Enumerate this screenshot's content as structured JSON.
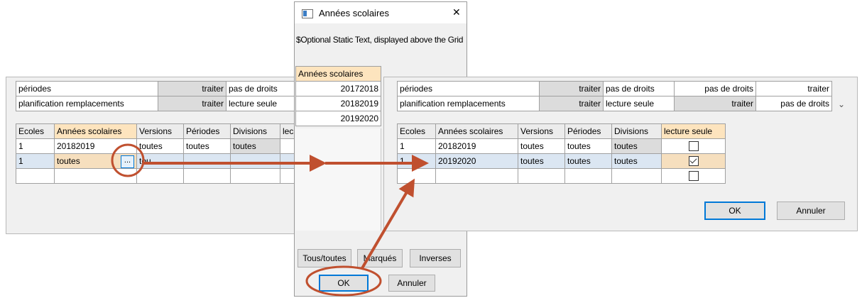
{
  "left_window": {
    "top_rows": [
      {
        "name": "périodes",
        "action": "traiter",
        "rights": "pas de droits"
      },
      {
        "name": "planification remplacements",
        "action": "traiter",
        "rights": "lecture seule"
      }
    ],
    "columns": [
      "Ecoles",
      "Années scolaires",
      "Versions",
      "Périodes",
      "Divisions",
      "lec"
    ],
    "rows": [
      [
        "1",
        "20182019",
        "toutes",
        "toutes",
        "toutes",
        ""
      ],
      [
        "1",
        "toutes",
        "tou",
        "",
        "",
        ""
      ],
      [
        "",
        "",
        "",
        "",
        "",
        ""
      ]
    ],
    "ellipsis_label": "..."
  },
  "dialog": {
    "title": "Années scolaires",
    "close_glyph": "✕",
    "static_text": "$Optional Static Text, displayed above the Grid",
    "column_header": "Années scolaires",
    "years": [
      "20172018",
      "20182019",
      "20192020"
    ],
    "buttons": {
      "all": "Tous/toutes",
      "marked": "Marqués",
      "inverse": "Inverses",
      "ok": "OK",
      "cancel": "Annuler"
    }
  },
  "right_window": {
    "top_rows": [
      {
        "name": "périodes",
        "action": "traiter",
        "rights": "pas de droits",
        "rights2": "pas de droits",
        "action2": "traiter"
      },
      {
        "name": "planification remplacements",
        "action": "traiter",
        "rights": "lecture seule",
        "rights2": "traiter",
        "action2": "pas de droits"
      }
    ],
    "columns": [
      "Ecoles",
      "Années scolaires",
      "Versions",
      "Périodes",
      "Divisions",
      "lecture seule"
    ],
    "rows": [
      {
        "cells": [
          "1",
          "20182019",
          "toutes",
          "toutes",
          "toutes"
        ],
        "checked": false
      },
      {
        "cells": [
          "1",
          "20192020",
          "toutes",
          "toutes",
          "toutes"
        ],
        "checked": true
      },
      {
        "cells": [
          "",
          "",
          "",
          "",
          ""
        ],
        "checked": false
      }
    ],
    "buttons": {
      "ok": "OK",
      "cancel": "Annuler"
    }
  },
  "colors": {
    "annotation": "#c0502f",
    "accent": "#0078d7",
    "selected_header": "#fde4be"
  },
  "icons": [
    "dialog-app-icon",
    "close-icon",
    "scroll-down-icon",
    "checkbox-icon",
    "arrow-annotation"
  ]
}
